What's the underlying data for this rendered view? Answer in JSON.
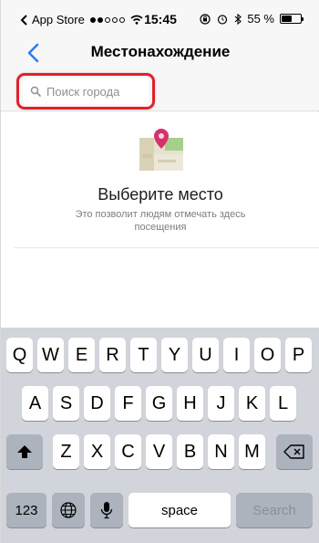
{
  "status_bar": {
    "app_back_label": "App Store",
    "time": "15:45",
    "battery_percent_text": "55 %",
    "battery_level": 0.55
  },
  "nav": {
    "title": "Местонахождение"
  },
  "search": {
    "placeholder": "Поиск города",
    "value": ""
  },
  "empty_state": {
    "title": "Выберите место",
    "subtitle": "Это позволит людям отмечать здесь посещения"
  },
  "keyboard": {
    "row1": [
      "Q",
      "W",
      "E",
      "R",
      "T",
      "Y",
      "U",
      "I",
      "O",
      "P"
    ],
    "row2": [
      "A",
      "S",
      "D",
      "F",
      "G",
      "H",
      "J",
      "K",
      "L"
    ],
    "row3": [
      "Z",
      "X",
      "C",
      "V",
      "B",
      "N",
      "M"
    ],
    "numbers_key": "123",
    "space_key": "space",
    "search_key": "Search"
  },
  "colors": {
    "accent": "#2f7cf6",
    "highlight": "#e3202b",
    "map_pin": "#d7316c"
  }
}
